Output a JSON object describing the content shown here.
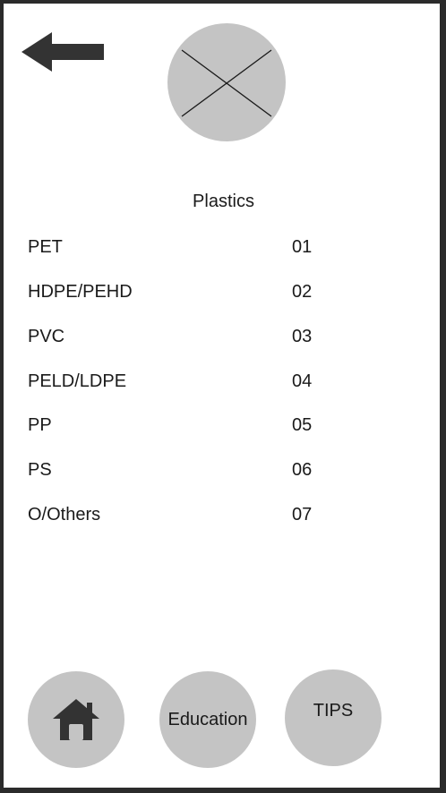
{
  "header": {
    "back_icon": "arrow-left-icon",
    "image_icon": "image-placeholder-icon"
  },
  "title": "Plastics",
  "plastics": [
    {
      "name": "PET",
      "code": "01"
    },
    {
      "name": "HDPE/PEHD",
      "code": "02"
    },
    {
      "name": "PVC",
      "code": "03"
    },
    {
      "name": "PELD/LDPE",
      "code": "04"
    },
    {
      "name": "PP",
      "code": "05"
    },
    {
      "name": "PS",
      "code": "06"
    },
    {
      "name": "O/Others",
      "code": "07"
    }
  ],
  "nav": {
    "home_icon": "home-icon",
    "education_label": "Education",
    "tips_label": "TIPS"
  },
  "colors": {
    "frame": "#2b2b2b",
    "circle": "#c4c4c4",
    "arrow": "#333333",
    "text": "#1a1a1a"
  }
}
